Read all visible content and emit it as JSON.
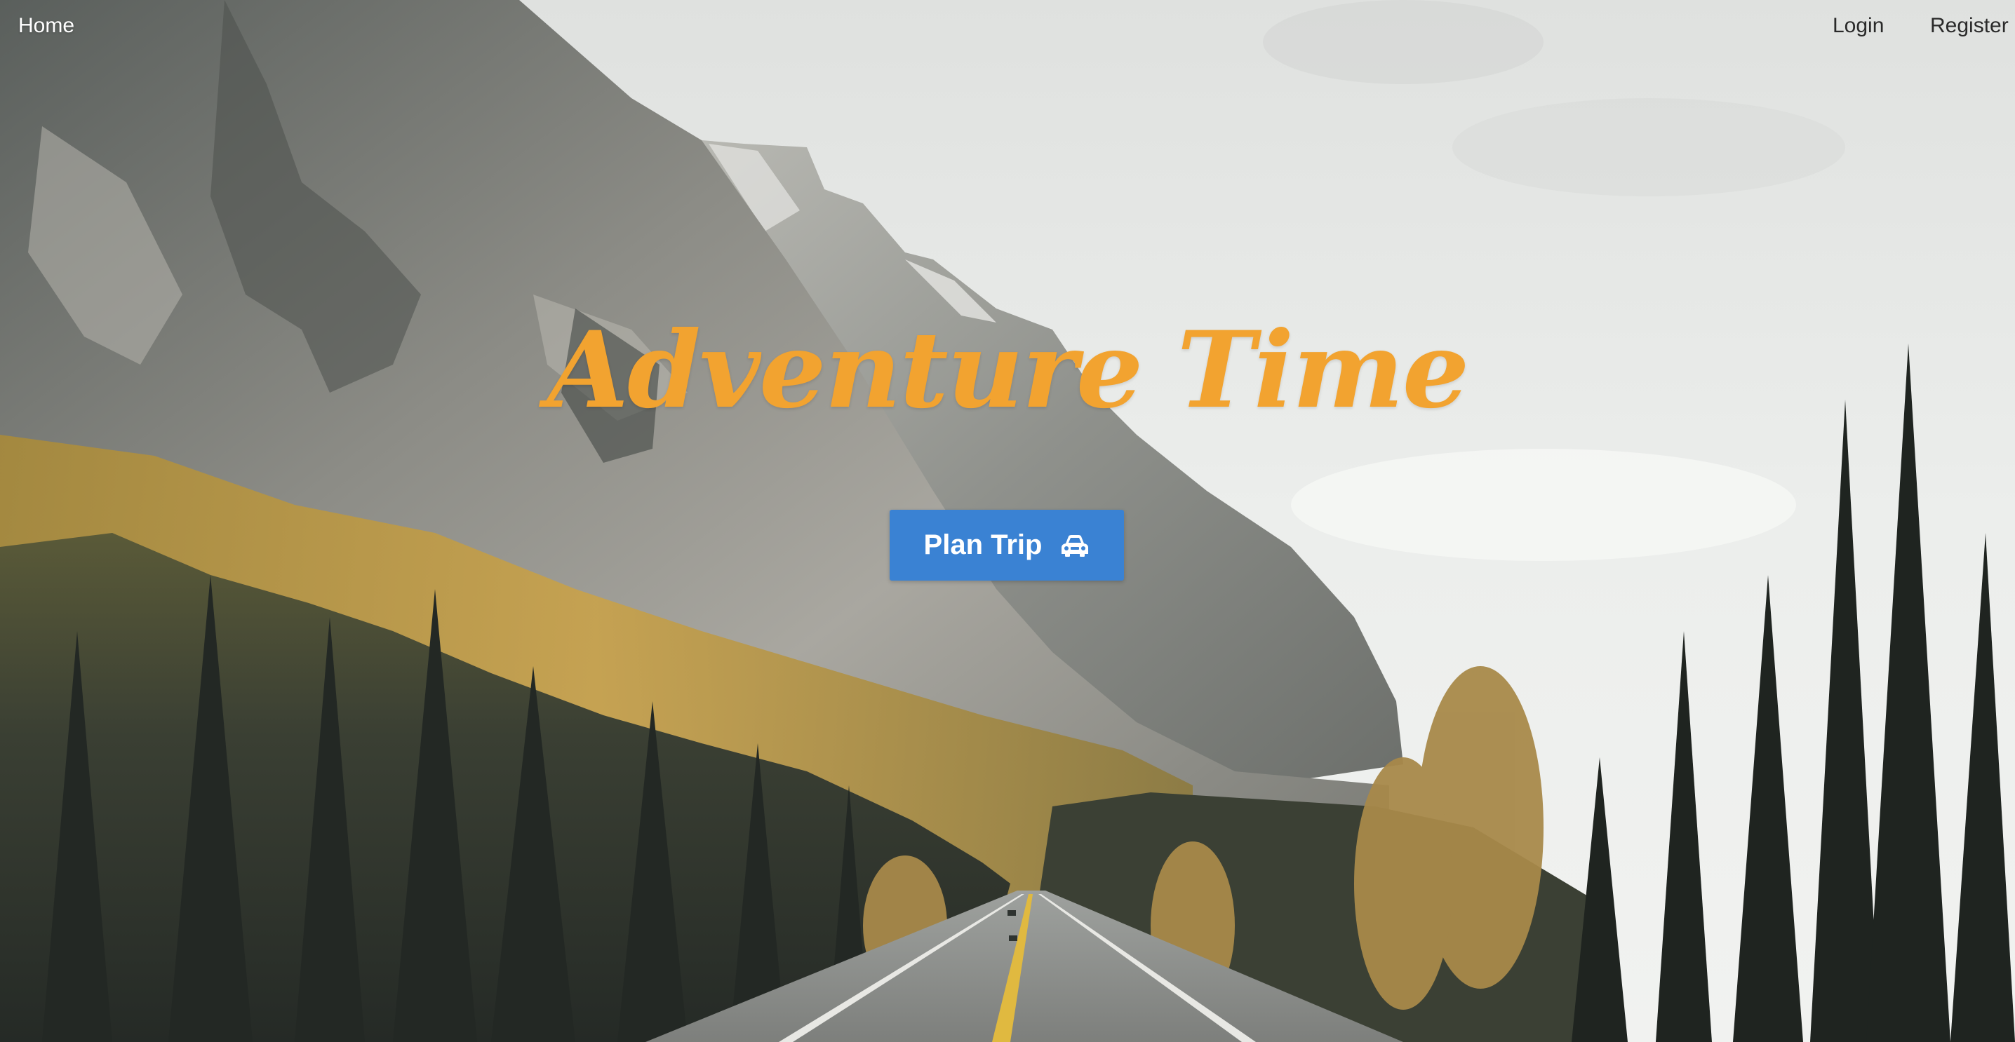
{
  "nav": {
    "home_label": "Home",
    "login_label": "Login",
    "register_label": "Register"
  },
  "hero": {
    "title": "Adventure Time",
    "button_label": "Plan Trip",
    "button_icon": "car-icon"
  },
  "colors": {
    "title": "#f2a330",
    "button": "#3a82d3",
    "sky": "#e9ebea"
  },
  "background": {
    "icon": "mountain-road-photo"
  }
}
